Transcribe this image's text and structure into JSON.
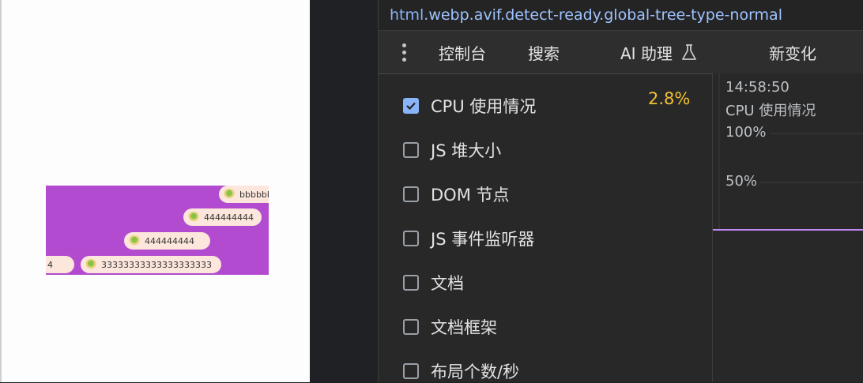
{
  "preview": {
    "danmaku": [
      {
        "text": "bbbbbb"
      },
      {
        "text": "444444444"
      },
      {
        "text": "444444444"
      },
      {
        "text": "4"
      },
      {
        "text": "33333333333333333333"
      }
    ]
  },
  "devtools": {
    "selector": {
      "tag": "html",
      "rest": ".webp.avif.detect-ready.global-tree-type-normal"
    },
    "tabs": [
      {
        "label": "控制台"
      },
      {
        "label": "搜索"
      },
      {
        "label": "AI 助理"
      },
      {
        "label": "新变化"
      }
    ],
    "metrics": [
      {
        "label": "CPU 使用情况",
        "checked": true
      },
      {
        "label": "JS 堆大小",
        "checked": false
      },
      {
        "label": "DOM 节点",
        "checked": false
      },
      {
        "label": "JS 事件监听器",
        "checked": false
      },
      {
        "label": "文档",
        "checked": false
      },
      {
        "label": "文档框架",
        "checked": false
      },
      {
        "label": "布局个数/秒",
        "checked": false
      }
    ],
    "cpu_value": "2.8%",
    "chart": {
      "timestamp": "14:58:50",
      "metric_label": "CPU 使用情况",
      "ticks": [
        "100%",
        "50%"
      ],
      "line_color": "#c58af9",
      "accent_color": "#f2c233"
    }
  }
}
